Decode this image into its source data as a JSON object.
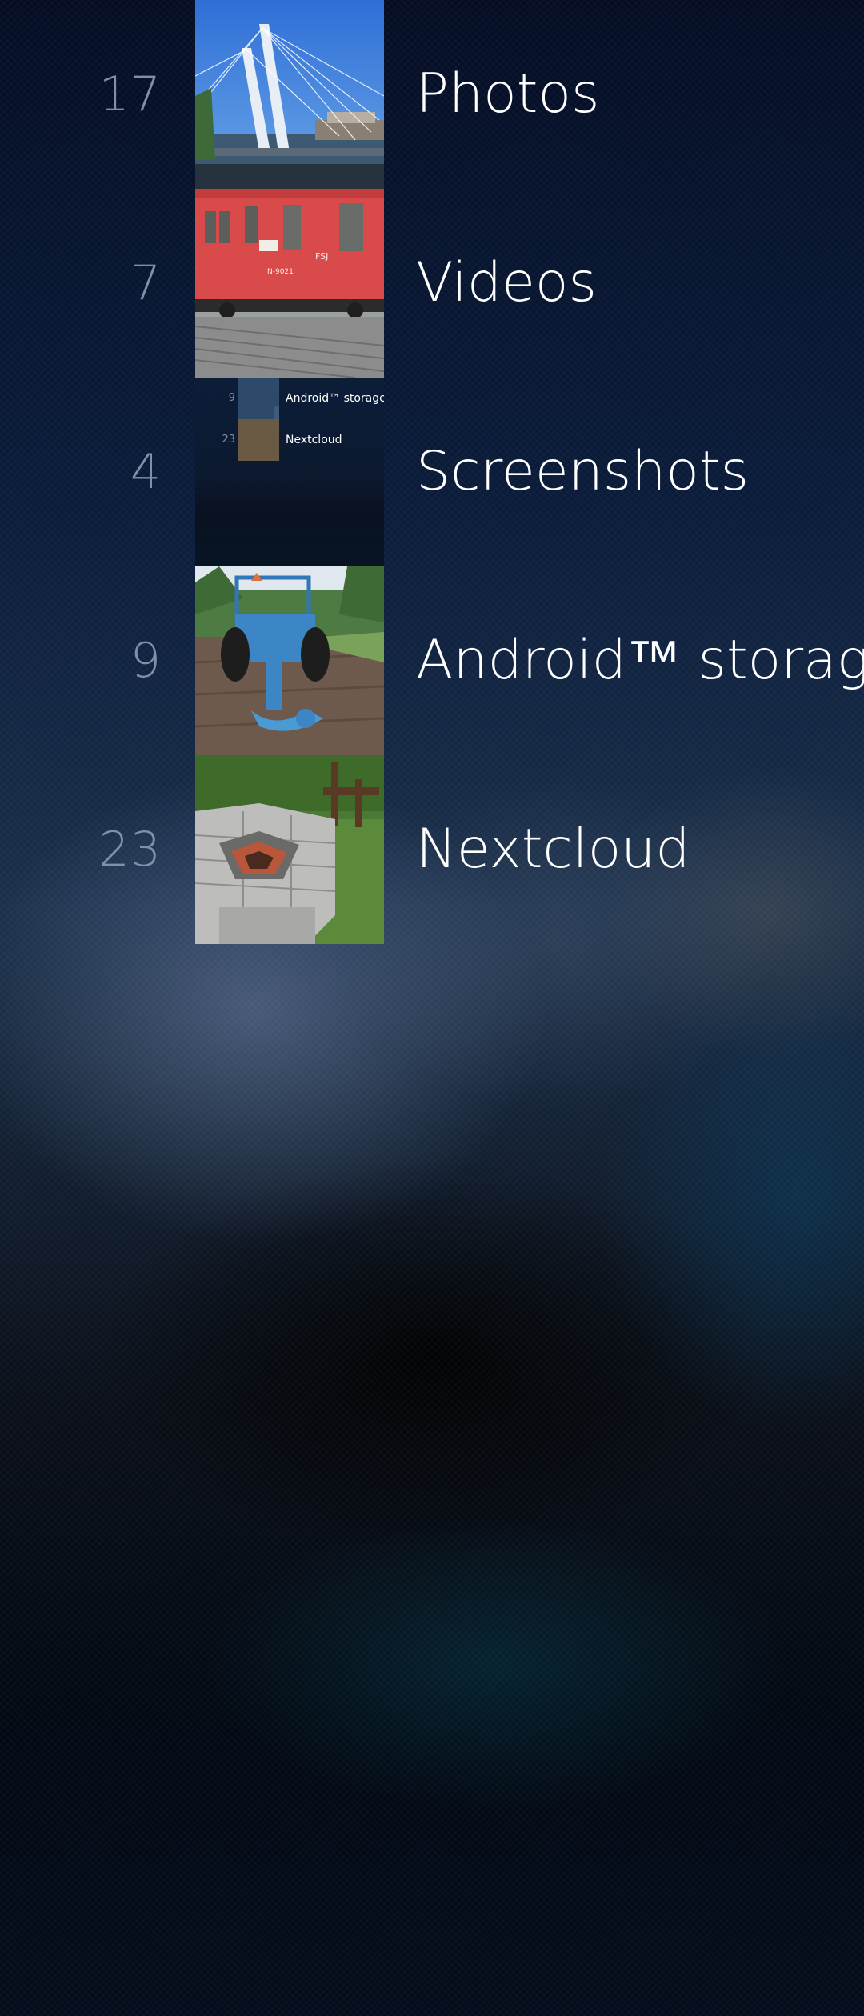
{
  "albums": [
    {
      "count": "17",
      "title": "Photos",
      "thumb_icon": "bridge-photo"
    },
    {
      "count": "7",
      "title": "Videos",
      "thumb_icon": "red-railway-car-photo"
    },
    {
      "count": "4",
      "title": "Screenshots",
      "thumb_icon": "screenshot-preview"
    },
    {
      "count": "9",
      "title": "Android™ storage",
      "thumb_icon": "tractor-photo"
    },
    {
      "count": "23",
      "title": "Nextcloud",
      "thumb_icon": "stone-grill-photo"
    }
  ],
  "screenshot_preview": {
    "rows": [
      {
        "count": "9",
        "title": "Android™ storage"
      },
      {
        "count": "23",
        "title": "Nextcloud"
      }
    ]
  },
  "colors": {
    "count_text": "#8190a8",
    "title_text": "#ffffff",
    "background_top": "#040d24"
  }
}
